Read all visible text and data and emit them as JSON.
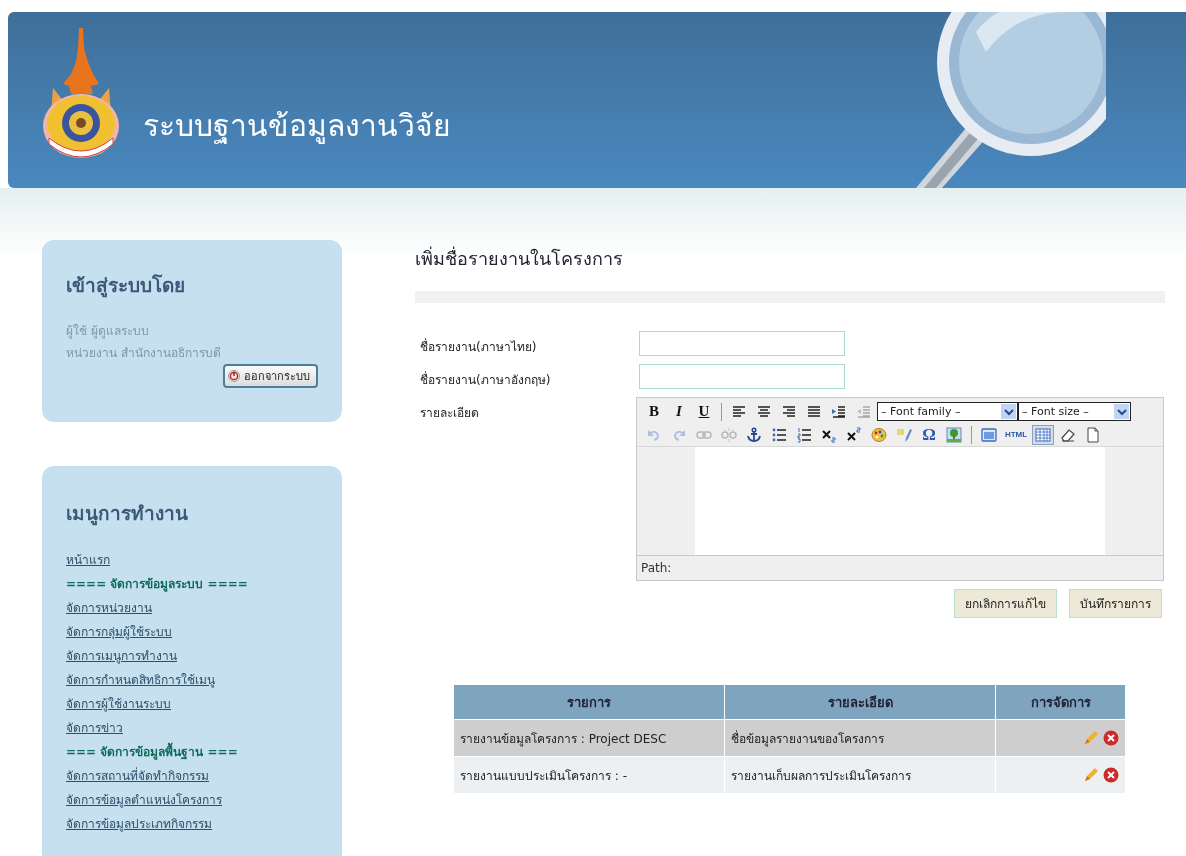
{
  "header": {
    "title": "ระบบฐานข้อมูลงานวิจัย"
  },
  "login_panel": {
    "heading": "เข้าสู่ระบบโดย",
    "lines": [
      "ผู้ใช้ ผู้ดูแลระบบ",
      "หน่วยงาน สำนักงานอธิการบดี"
    ],
    "logout_button": "ออกจากระบบ"
  },
  "menu_panel": {
    "heading": "เมนูการทำงาน",
    "items": [
      {
        "kind": "link",
        "label": "หน้าแรก"
      },
      {
        "kind": "header",
        "label": "==== จัดการข้อมูลระบบ ===="
      },
      {
        "kind": "link",
        "label": "จัดการหน่วยงาน"
      },
      {
        "kind": "link",
        "label": "จัดการกลุ่มผู้ใช้ระบบ"
      },
      {
        "kind": "link",
        "label": "จัดการเมนูการทำงาน"
      },
      {
        "kind": "link",
        "label": "จัดการกำหนดสิทธิการใช้เมนู"
      },
      {
        "kind": "link",
        "label": "จัดการผู้ใช้งานระบบ"
      },
      {
        "kind": "link",
        "label": "จัดการข่าว"
      },
      {
        "kind": "header",
        "label": "=== จัดการข้อมูลพื้นฐาน ==="
      },
      {
        "kind": "link",
        "label": "จัดการสถานที่จัดทำกิจกรรม"
      },
      {
        "kind": "link",
        "label": "จัดการข้อมูลตำแหน่งโครงการ"
      },
      {
        "kind": "link",
        "label": "จัดการข้อมูลประเภทกิจกรรม"
      }
    ]
  },
  "form": {
    "title": "เพิ่มชื่อรายงานในโครงการ",
    "fields": [
      {
        "label": "ชื่อรายงาน(ภาษาไทย)"
      },
      {
        "label": "ชื่อรายงาน(ภาษาอังกฤษ)"
      }
    ],
    "editor": {
      "label": "รายละเอียด",
      "toolbar_rows": [
        [
          {
            "kind": "bold",
            "label": "B",
            "disabled": false,
            "active": false
          },
          {
            "kind": "italic",
            "label": "I",
            "disabled": false,
            "active": false
          },
          {
            "kind": "underline",
            "label": "U",
            "disabled": false,
            "active": false
          },
          {
            "kind": "separator"
          },
          {
            "kind": "align-left",
            "disabled": false,
            "active": false
          },
          {
            "kind": "align-center",
            "disabled": false,
            "active": false
          },
          {
            "kind": "align-right",
            "disabled": false,
            "active": false
          },
          {
            "kind": "justify",
            "disabled": false,
            "active": false
          },
          {
            "kind": "indent",
            "disabled": false,
            "active": false
          },
          {
            "kind": "outdent",
            "disabled": true,
            "active": false
          },
          {
            "kind": "select",
            "value": "– Font family –"
          },
          {
            "kind": "select",
            "value": "– Font size –"
          }
        ],
        [
          {
            "kind": "undo",
            "disabled": true,
            "active": false
          },
          {
            "kind": "redo",
            "disabled": true,
            "active": false
          },
          {
            "kind": "link",
            "disabled": true,
            "active": false
          },
          {
            "kind": "unlink",
            "disabled": true,
            "active": false
          },
          {
            "kind": "anchor",
            "disabled": false,
            "active": false
          },
          {
            "kind": "bullets",
            "disabled": false,
            "active": false
          },
          {
            "kind": "numbers",
            "disabled": false,
            "active": false
          },
          {
            "kind": "subscript",
            "disabled": false,
            "active": false
          },
          {
            "kind": "superscript",
            "disabled": false,
            "active": false
          },
          {
            "kind": "palette",
            "disabled": false,
            "active": false
          },
          {
            "kind": "pencil",
            "disabled": false,
            "active": false
          },
          {
            "kind": "charmap",
            "label": "Ω",
            "disabled": false,
            "active": false
          },
          {
            "kind": "image",
            "disabled": false,
            "active": false
          },
          {
            "kind": "separator"
          },
          {
            "kind": "window",
            "disabled": false,
            "active": false
          },
          {
            "kind": "html",
            "label": "HTML",
            "disabled": false,
            "active": false
          },
          {
            "kind": "table",
            "disabled": false,
            "active": true
          },
          {
            "kind": "eraser",
            "disabled": false,
            "active": false
          },
          {
            "kind": "page",
            "disabled": false,
            "active": false
          }
        ]
      ],
      "path_label": "Path:"
    },
    "buttons": [
      "ยกเลิกการแก้ไข",
      "บันทึกรายการ"
    ]
  },
  "table": {
    "columns": [
      "รายการ",
      "รายละเอียด",
      "การจัดการ"
    ],
    "rows": [
      {
        "cells": [
          "รายงานข้อมูลโครงการ : Project DESC",
          "ชื่อข้อมูลรายงานของโครงการ"
        ]
      },
      {
        "cells": [
          "รายงานแบบประเมินโครงการ : -",
          "รายงานเก็บผลการประเมินโครงการ"
        ]
      }
    ]
  }
}
